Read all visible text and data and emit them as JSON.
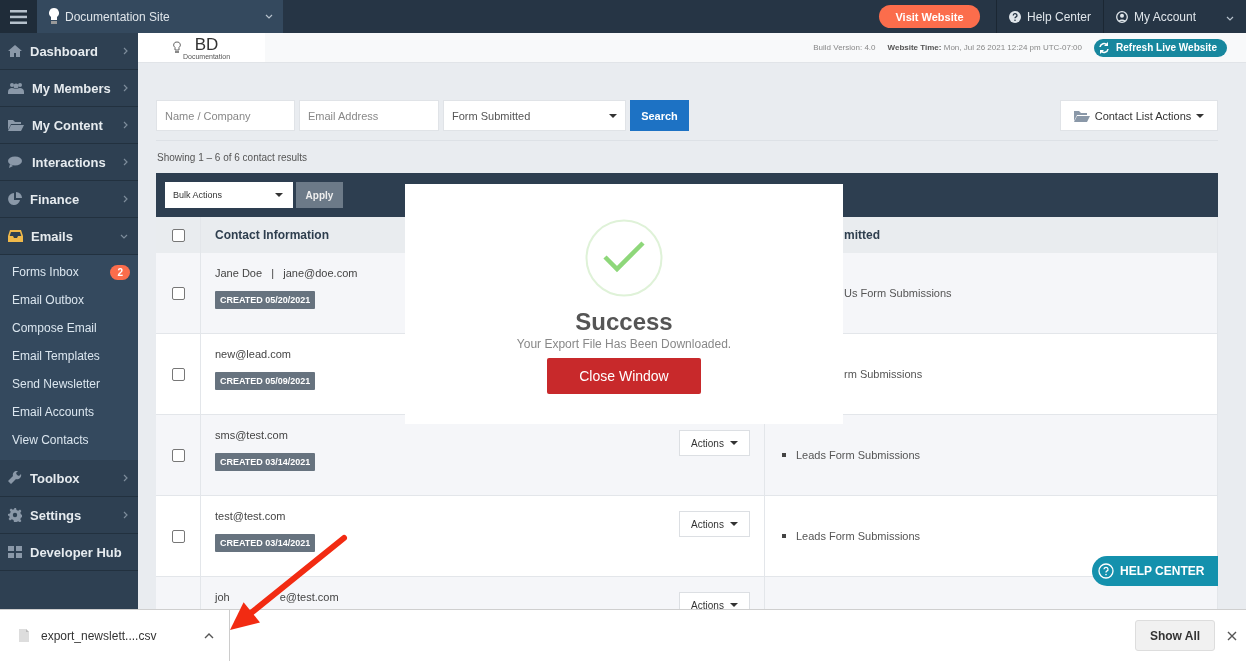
{
  "topbar": {
    "site": "Documentation Site",
    "visit_button": "Visit Website",
    "help": "Help Center",
    "account": "My Account"
  },
  "header": {
    "logo": "BD",
    "logo_sub": "Documentation",
    "build": "Build Version: 4.0",
    "time_label": "Website Time:",
    "time_value": "Mon, Jul 26 2021 12:24 pm UTC-07:00",
    "refresh_button": "Refresh Live Website"
  },
  "sidebar": {
    "items": [
      {
        "label": "Dashboard",
        "expanded": false
      },
      {
        "label": "My Members",
        "expanded": false
      },
      {
        "label": "My Content",
        "expanded": false
      },
      {
        "label": "Interactions",
        "expanded": false
      },
      {
        "label": "Finance",
        "expanded": false
      },
      {
        "label": "Emails",
        "expanded": true,
        "children": [
          {
            "label": "Forms Inbox",
            "badge": "2"
          },
          {
            "label": "Email Outbox"
          },
          {
            "label": "Compose Email"
          },
          {
            "label": "Email Templates"
          },
          {
            "label": "Send Newsletter"
          },
          {
            "label": "Email Accounts"
          },
          {
            "label": "View Contacts"
          }
        ]
      },
      {
        "label": "Toolbox",
        "expanded": false
      },
      {
        "label": "Settings",
        "expanded": false
      },
      {
        "label": "Developer Hub"
      }
    ]
  },
  "filters": {
    "name_placeholder": "Name / Company",
    "email_placeholder": "Email Address",
    "form_select": "Form Submitted",
    "search_button": "Search",
    "list_actions": "Contact List Actions"
  },
  "results_text": "Showing 1 – 6 of 6 contact results",
  "table": {
    "bulk_select": "Bulk Actions",
    "apply_button": "Apply",
    "header_checked": false,
    "columns": [
      "Contact Information",
      "mitted"
    ],
    "rows": [
      {
        "checked": false,
        "email": "Jane Doe   |   jane@doe.com",
        "created": "CREATED 05/20/2021",
        "submission": "Us Form Submissions",
        "bullet": false
      },
      {
        "checked": false,
        "email": "new@lead.com",
        "created": "CREATED 05/09/2021",
        "submission": "rm Submissions",
        "bullet": false
      },
      {
        "checked": false,
        "email": "sms@test.com",
        "created": "CREATED 03/14/2021",
        "actions": "Actions",
        "submission": "Leads Form Submissions",
        "bullet": true
      },
      {
        "checked": false,
        "email": "test@test.com",
        "created": "CREATED 03/14/2021",
        "actions": "Actions",
        "submission": "Leads Form Submissions",
        "bullet": true
      },
      {
        "email": "joh",
        "email_tail": "e@test.com",
        "actions": "Actions"
      }
    ]
  },
  "modal": {
    "title": "Success",
    "message": "Your Export File Has Been Downloaded.",
    "close_button": "Close Window"
  },
  "help_button": "HELP CENTER",
  "download_bar": {
    "file": "export_newslett....csv",
    "show_all": "Show All"
  }
}
